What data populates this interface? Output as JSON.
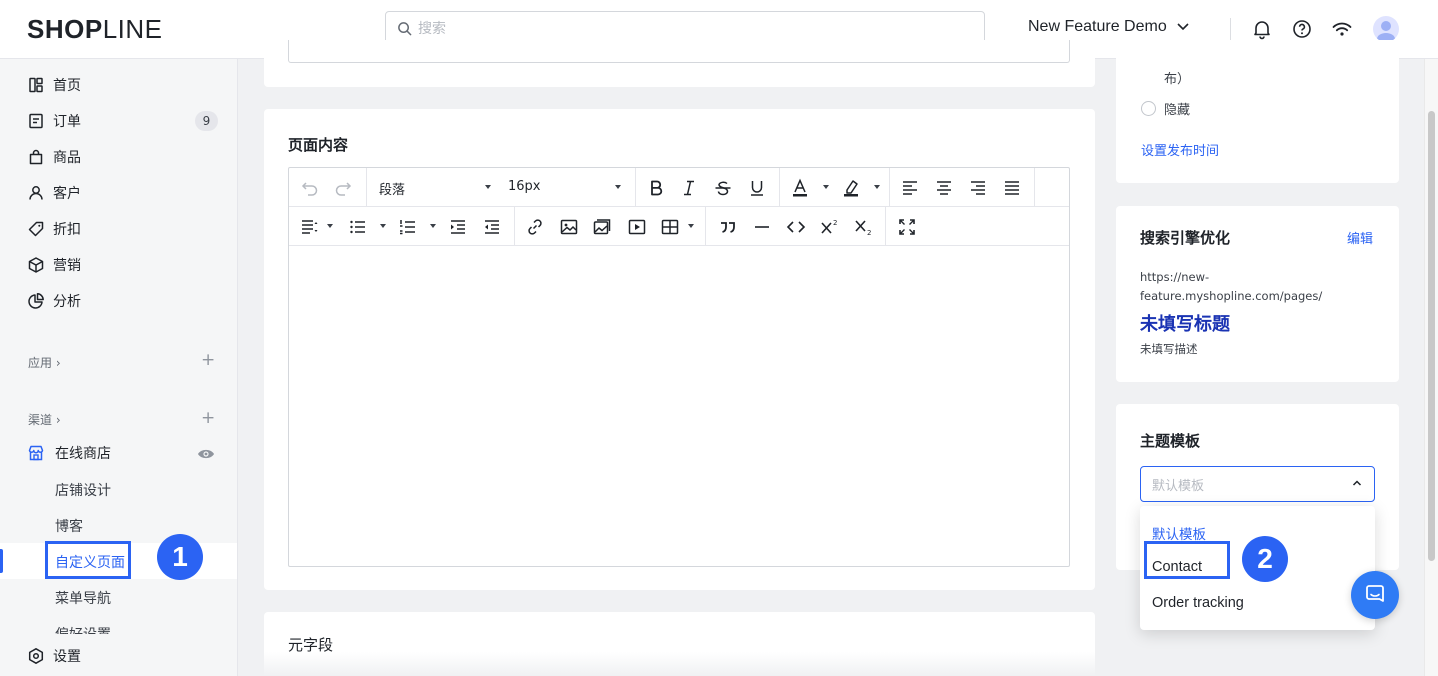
{
  "app": {
    "logo_bold": "SH",
    "logo_o": "O",
    "logo_p": "P",
    "logo_rest": "LINE"
  },
  "header": {
    "search_placeholder": "搜索",
    "store_name": "New Feature Demo"
  },
  "sidebar": {
    "items": [
      {
        "label": "首页",
        "icon": "home-icon"
      },
      {
        "label": "订单",
        "icon": "order-icon"
      },
      {
        "label": "商品",
        "icon": "product-bag-icon"
      },
      {
        "label": "客户",
        "icon": "customer-icon"
      },
      {
        "label": "折扣",
        "icon": "discount-tag-icon"
      },
      {
        "label": "营销",
        "icon": "marketing-box-icon"
      },
      {
        "label": "分析",
        "icon": "analytics-pie-icon"
      }
    ],
    "orders_badge": "9",
    "apps_section": "应用 ›",
    "channels_section": "渠道 ›",
    "online_store": "在线商店",
    "sub_items": [
      "店铺设计",
      "博客",
      "自定义页面",
      "菜单导航",
      "偏好设置"
    ],
    "settings": "设置"
  },
  "annotations": {
    "step1": "1",
    "step2": "2"
  },
  "main": {
    "content_card_title": "页面内容",
    "toolbar": {
      "block_format": "段落",
      "font_size": "16px"
    },
    "meta_card_title": "元字段"
  },
  "right": {
    "visibility_partial": "布）",
    "hidden_label": "隐藏",
    "set_publish_time": "设置发布时间",
    "seo_title": "搜索引擎优化",
    "seo_edit": "编辑",
    "seo_url": "https://new-feature.myshopline.com/pages/",
    "seo_url_line1": "https://new-",
    "seo_url_line2": "feature.myshopline.com/pages/",
    "seo_page_title": "未填写标题",
    "seo_description": "未填写描述",
    "theme_title": "主题模板",
    "theme_placeholder": "默认模板",
    "theme_options": [
      "默认模板",
      "Contact",
      "Order tracking"
    ]
  },
  "colors": {
    "accent": "#2b63f3",
    "seo_title": "#1a33b3",
    "chat": "#2f7bf5"
  }
}
